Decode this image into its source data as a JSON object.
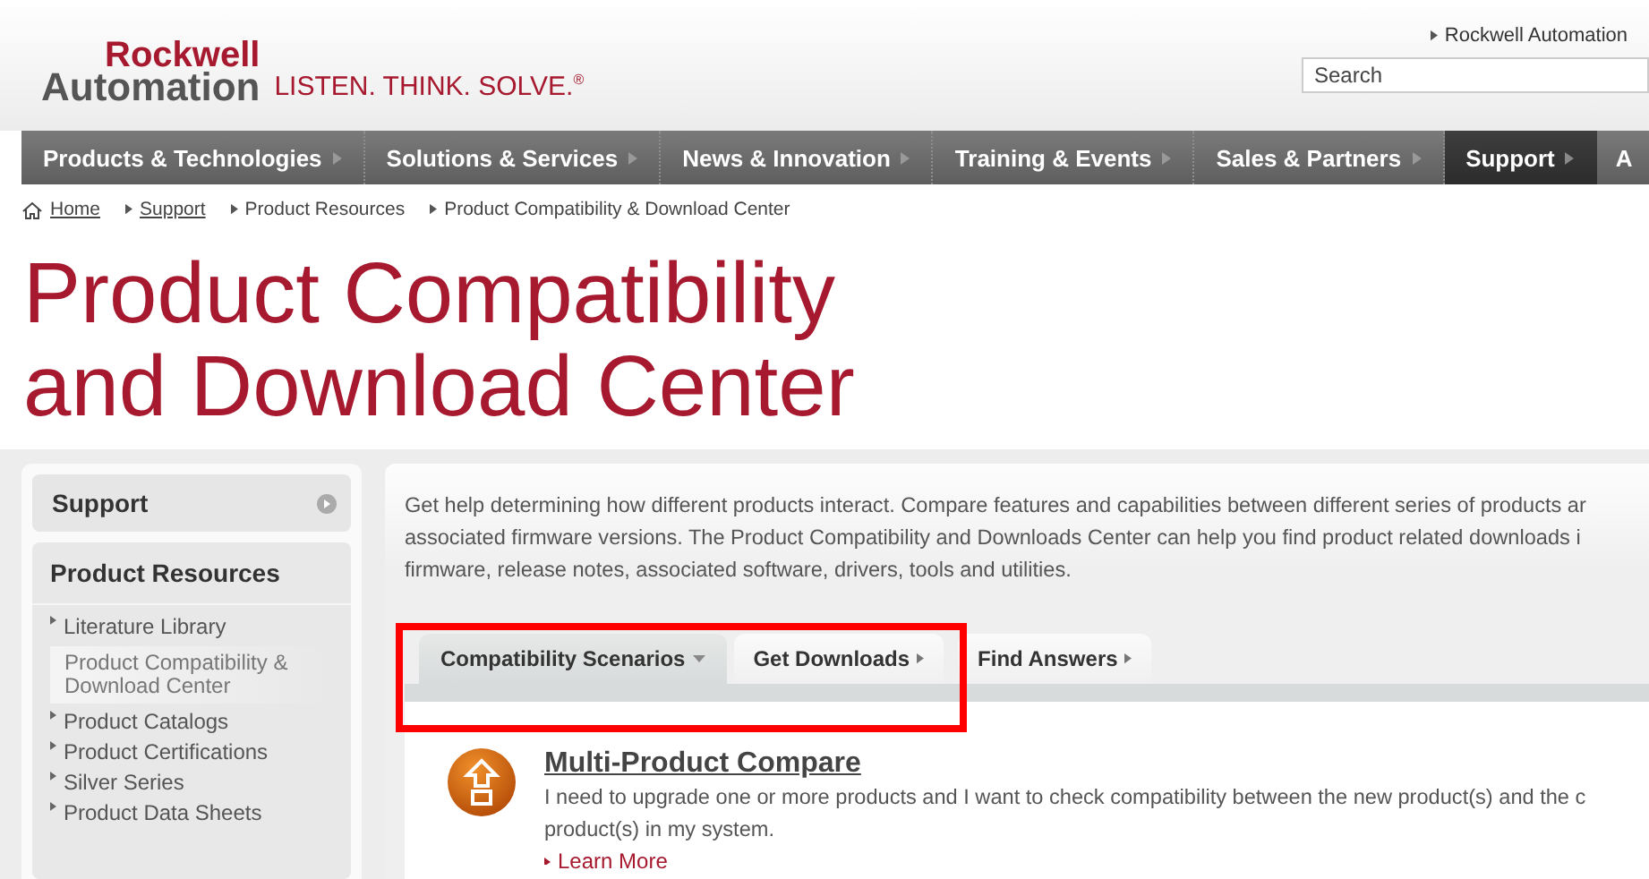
{
  "header": {
    "logo": {
      "line_1": "Rockwell",
      "line_2": "Automation"
    },
    "tagline": "LISTEN. THINK. SOLVE.$^{®}$",
    "top_link": "Rockwell Automation",
    "search": {
      "placeholder": "Search"
    }
  },
  "nav": [
    {
      "label": "Products & Technologies",
      "selected": false
    },
    {
      "label": "Solutions & Services",
      "selected": false
    },
    {
      "label": "News & Innovation",
      "selected": false
    },
    {
      "label": "Training & Events",
      "selected": false
    },
    {
      "label": "Sales & Partners",
      "selected": false
    },
    {
      "label": "Support",
      "selected": true
    },
    {
      "label": "A",
      "selected": false
    }
  ],
  "breadcrumb": [
    {
      "label": "Home",
      "kind": "home"
    },
    {
      "label": "Support",
      "kind": "link"
    },
    {
      "label": "Product Resources",
      "kind": "text"
    },
    {
      "label": "Product Compatibility & Download Center",
      "kind": "text"
    }
  ],
  "title": [
    "Product Compatibility",
    "and Download Center"
  ],
  "sidebar": {
    "header": "Support",
    "section": "Product Resources",
    "items": [
      {
        "label": "Literature Library",
        "selected": false
      },
      {
        "label": "Product Compatibility & Download Center",
        "selected": true
      },
      {
        "label": "Product Catalogs",
        "selected": false
      },
      {
        "label": "Product Certifications",
        "selected": false
      },
      {
        "label": "Silver Series",
        "selected": false
      },
      {
        "label": "Product Data Sheets",
        "selected": false
      }
    ]
  },
  "intro": [
    "Get help determining how different products interact. Compare features and capabilities between different series of products ar",
    "associated firmware versions. The Product Compatibility and Downloads Center can help you find product related downloads i",
    "firmware, release notes, associated software, drivers, tools and utilities."
  ],
  "tabs": [
    {
      "label": "Compatibility Scenarios",
      "selected": true,
      "kind": "dropdown"
    },
    {
      "label": "Get Downloads",
      "selected": false,
      "kind": "arrow"
    },
    {
      "label": "Find Answers",
      "selected": false,
      "kind": "arrow"
    }
  ],
  "highlight_box": true,
  "card": {
    "title": "Multi-Product Compare",
    "description": [
      "I need to upgrade one or more products and I want to check compatibility between the new product(s) and the c",
      "product(s) in my system."
    ],
    "link": "Learn More"
  }
}
